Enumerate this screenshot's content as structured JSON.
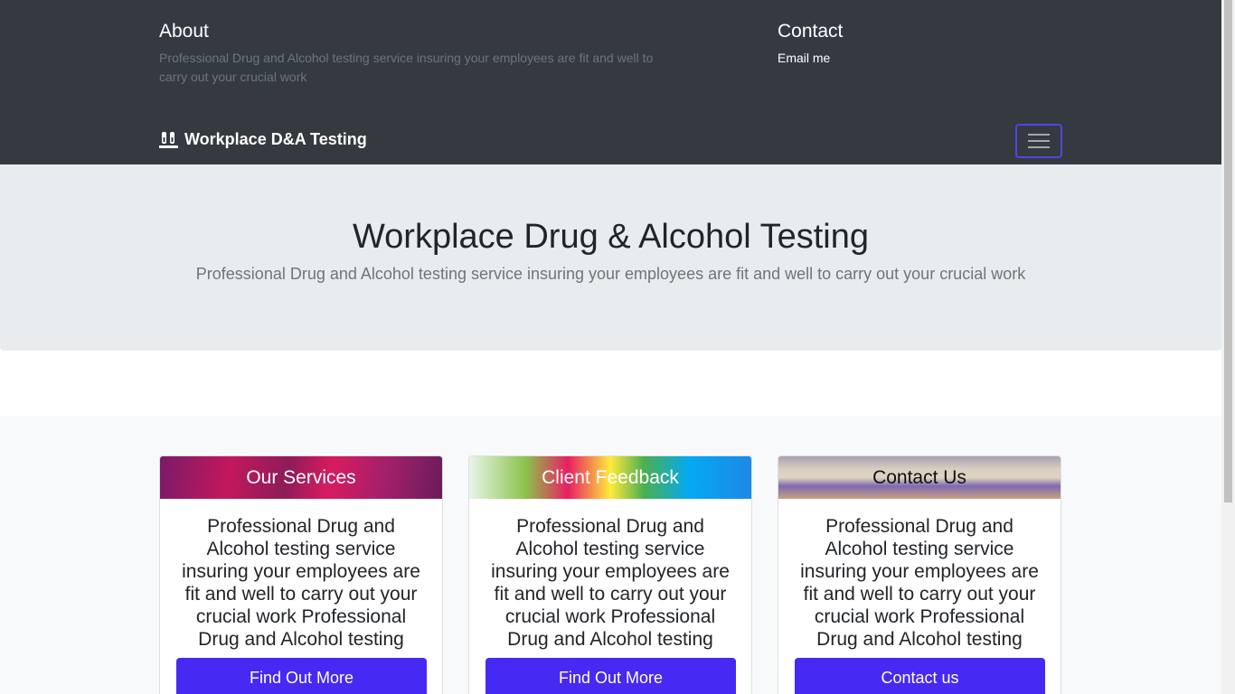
{
  "header": {
    "about": {
      "title": "About",
      "text": "Professional Drug and Alcohol testing service insuring your employees are fit and well to carry out your crucial work"
    },
    "contact": {
      "title": "Contact",
      "email_link": "Email me"
    },
    "brand": {
      "label": "Workplace D&A Testing",
      "icon": "test-tubes-icon"
    },
    "toggler_icon": "hamburger-menu-icon",
    "toggler_border_color": "#4f46e5"
  },
  "hero": {
    "title": "Workplace Drug & Alcohol Testing",
    "subtitle": "Professional Drug and Alcohol testing service insuring your employees are fit and well to carry out your crucial work"
  },
  "cards": [
    {
      "title": "Our Services",
      "text": "Professional Drug and Alcohol testing service insuring your employees are fit and well to carry out your crucial work Professional Drug and Alcohol testing",
      "button": "Find Out More"
    },
    {
      "title": "Client Feedback",
      "text": "Professional Drug and Alcohol testing service insuring your employees are fit and well to carry out your crucial work Professional Drug and Alcohol testing",
      "button": "Find Out More"
    },
    {
      "title": "Contact Us",
      "text": "Professional Drug and Alcohol testing service insuring your employees are fit and well to carry out your crucial work Professional Drug and Alcohol testing",
      "button": "Contact us"
    }
  ],
  "colors": {
    "navbar_bg": "#343a40",
    "hero_bg": "#e9ecef",
    "button_bg": "#4629f2"
  }
}
